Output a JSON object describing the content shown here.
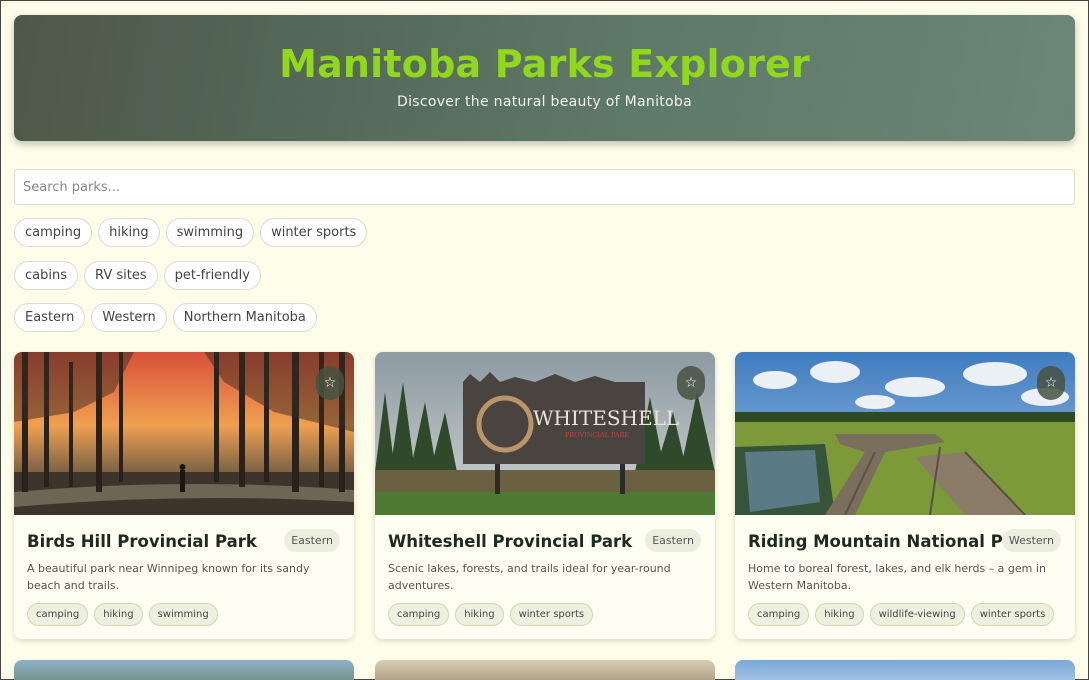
{
  "header": {
    "title": "Manitoba Parks Explorer",
    "subtitle": "Discover the natural beauty of Manitoba"
  },
  "search": {
    "placeholder": "Search parks..."
  },
  "filters": {
    "activities": [
      "camping",
      "hiking",
      "swimming",
      "winter sports"
    ],
    "amenities": [
      "cabins",
      "RV sites",
      "pet-friendly"
    ],
    "regions": [
      "Eastern",
      "Western",
      "Northern Manitoba"
    ]
  },
  "favorite_icon": "☆",
  "parks": [
    {
      "name": "Birds Hill Provincial Park",
      "region": "Eastern",
      "description": "A beautiful park near Winnipeg known for its sandy beach and trails.",
      "tags": [
        "camping",
        "hiking",
        "swimming"
      ]
    },
    {
      "name": "Whiteshell Provincial Park",
      "region": "Eastern",
      "description": "Scenic lakes, forests, and trails ideal for year-round adventures.",
      "tags": [
        "camping",
        "hiking",
        "winter sports"
      ],
      "sign_text": "WHITESHELL",
      "sign_subtext": "PROVINCIAL PARK"
    },
    {
      "name": "Riding Mountain National Park",
      "region": "Western",
      "description": "Home to boreal forest, lakes, and elk herds – a gem in Western Manitoba.",
      "tags": [
        "camping",
        "hiking",
        "wildlife-viewing",
        "winter sports"
      ]
    }
  ],
  "colors": {
    "title_green": "#8fd81c",
    "page_bg": "#fdfde9"
  }
}
